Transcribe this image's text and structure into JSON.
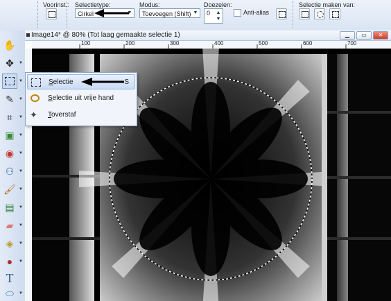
{
  "optionsbar": {
    "preset_label": "Voorinst.:",
    "selection_type_label": "Selectietype:",
    "selection_type_value": "Cirkel",
    "mode_label": "Modus:",
    "mode_value": "Toevoegen (Shift)",
    "feather_label": "Doezelen:",
    "feather_value": "0",
    "antialias_label": "Anti-alias",
    "antialias_checked": false,
    "make_selection_label": "Selectie maken van:"
  },
  "image_window": {
    "title": "Image14* @  80% (Tot laag gemaakte selectie 1)",
    "ruler_labels": [
      "100",
      "200",
      "300",
      "400",
      "500",
      "600",
      "700"
    ]
  },
  "selection_menu": {
    "items": [
      {
        "pre": "",
        "u": "S",
        "post": "electie",
        "shortcut": "S",
        "icon": "rectangle-selection-icon"
      },
      {
        "pre": "",
        "u": "S",
        "post": "electie uit vrije hand",
        "shortcut": "",
        "icon": "lasso-icon"
      },
      {
        "pre": "",
        "u": "T",
        "post": "overstaf",
        "shortcut": "",
        "icon": "magic-wand-icon"
      }
    ]
  },
  "tools": [
    "pan-icon",
    "move-icon",
    "selection-icon",
    "eyedropper-icon",
    "crop-icon",
    "picture-tube-icon",
    "red-eye-icon",
    "clone-icon",
    "paint-brush-icon",
    "color-replace-icon",
    "eraser-icon",
    "flood-fill-icon",
    "picture-fill-icon",
    "text-icon",
    "shape-icon"
  ],
  "colors": {
    "accent": "#3c6fb5",
    "menu_highlight": "#c9dbf3"
  }
}
